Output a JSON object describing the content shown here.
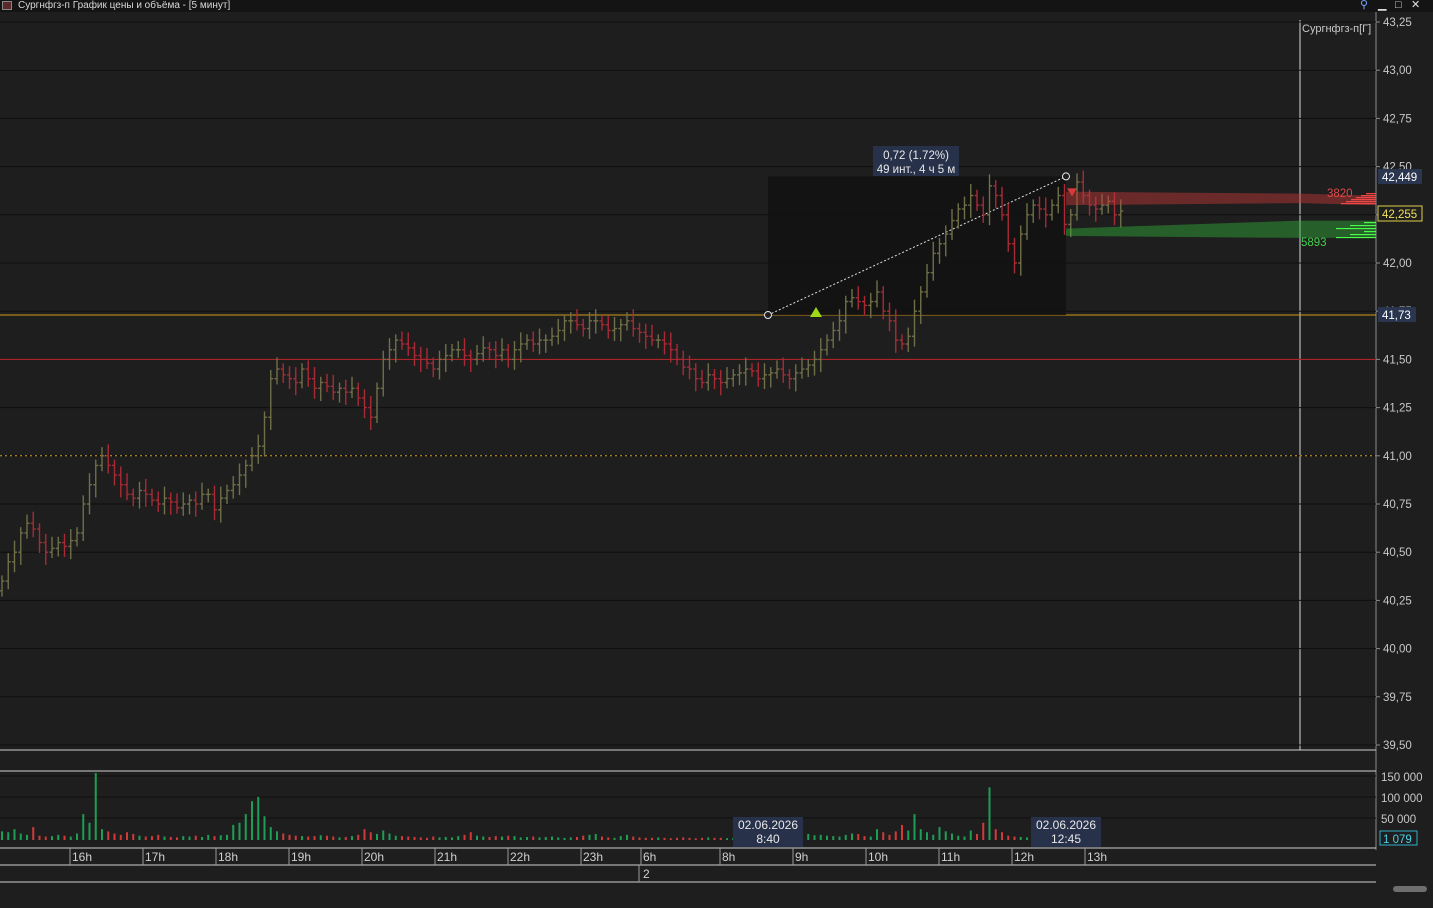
{
  "window": {
    "title": "Сургнфгз-п График цены и объёма - [5 минут]",
    "controls": {
      "pin": "⚲",
      "minimize": "▁",
      "maximize": "□",
      "close": "✕"
    }
  },
  "colors": {
    "background": "#1e1e1e",
    "grid": "#111111",
    "up_candle": "#6f6f48",
    "down_candle": "#a82a35",
    "level_line": "#d29a17",
    "support_line": "#c0282e",
    "dotted_line": "#d7a321",
    "volume_up": "#1e9e55",
    "volume_down": "#d23a3a",
    "measure_box": "#121212",
    "ask_profile": "#c83a3a",
    "bid_profile": "#33b03a"
  },
  "price_panel": {
    "instrument_label": "Сургнфгз-п[Г]",
    "tick_labels": [
      "43,25",
      "43,00",
      "42,75",
      "42,50",
      "42,25",
      "42,00",
      "41,75",
      "41,50",
      "41,25",
      "41,00",
      "40,75",
      "40,50",
      "40,25",
      "40,00",
      "39,75",
      "39,50"
    ],
    "markers": {
      "high_mark": "42,449",
      "last_price": "42,255",
      "level": "41,73"
    },
    "ask_volume_label": "3820",
    "bid_volume_label": "5893",
    "measure_tooltip": {
      "line1": "0,72 (1.72%)",
      "line2": "49 инт., 4 ч 5 м"
    }
  },
  "volume_panel": {
    "tick_labels": [
      "150 000",
      "100 000",
      "50 000"
    ],
    "last_volume": "1 079",
    "cursor_labels": [
      {
        "date": "02.06.2026",
        "time": "8:40"
      },
      {
        "date": "02.06.2026",
        "time": "12:45"
      }
    ]
  },
  "time_axis": {
    "labels": [
      "16h",
      "17h",
      "18h",
      "19h",
      "20h",
      "21h",
      "22h",
      "23h",
      "6h",
      "8h",
      "9h",
      "10h",
      "11h",
      "12h",
      "13h"
    ],
    "day_label": "2"
  },
  "chart_data": {
    "type": "candlestick",
    "interval": "5 минут",
    "ylim": [
      39.5,
      43.25
    ],
    "volume_ylim": [
      0,
      160000
    ],
    "horizontal_levels": [
      {
        "price": 41.73,
        "style": "solid",
        "color": "#d29a17"
      },
      {
        "price": 41.5,
        "style": "solid",
        "color": "#c0282e"
      },
      {
        "price": 41.0,
        "style": "dotted",
        "color": "#d7a321"
      }
    ],
    "measurement": {
      "start": {
        "time": "8:40",
        "price": 41.73
      },
      "end": {
        "time": "12:45",
        "price": 42.449
      },
      "change": "0,72 (1.72%)",
      "span": "49 инт., 4 ч 5 м"
    },
    "series_close": [
      40.35,
      40.45,
      40.5,
      40.6,
      40.65,
      40.62,
      40.55,
      40.5,
      40.52,
      40.55,
      40.53,
      40.56,
      40.6,
      40.75,
      40.85,
      40.95,
      41.0,
      40.95,
      40.9,
      40.85,
      40.8,
      40.78,
      40.82,
      40.8,
      40.77,
      40.75,
      40.78,
      40.76,
      40.73,
      40.75,
      40.77,
      40.75,
      40.8,
      40.8,
      40.72,
      40.78,
      40.82,
      40.85,
      40.9,
      40.95,
      41.0,
      41.05,
      41.2,
      41.4,
      41.45,
      41.42,
      41.4,
      41.38,
      41.45,
      41.4,
      41.35,
      41.38,
      41.36,
      41.33,
      41.35,
      41.33,
      41.35,
      41.3,
      41.25,
      41.2,
      41.35,
      41.5,
      41.55,
      41.6,
      41.58,
      41.56,
      41.52,
      41.5,
      41.48,
      41.45,
      41.5,
      41.52,
      41.55,
      41.55,
      41.52,
      41.5,
      41.53,
      41.56,
      41.55,
      41.52,
      41.55,
      41.5,
      41.55,
      41.58,
      41.6,
      41.58,
      41.6,
      41.6,
      41.62,
      41.65,
      41.7,
      41.7,
      41.68,
      41.66,
      41.7,
      41.7,
      41.68,
      41.65,
      41.66,
      41.68,
      41.7,
      41.66,
      41.64,
      41.62,
      41.6,
      41.6,
      41.58,
      41.55,
      41.5,
      41.46,
      41.45,
      41.4,
      41.38,
      41.42,
      41.4,
      41.38,
      41.4,
      41.42,
      41.43,
      41.45,
      41.44,
      41.4,
      41.42,
      41.43,
      41.45,
      41.42,
      41.4,
      41.43,
      41.45,
      41.47,
      41.5,
      41.55,
      41.6,
      41.65,
      41.7,
      41.8,
      41.82,
      41.8,
      41.78,
      41.8,
      41.85,
      41.75,
      41.7,
      41.6,
      41.58,
      41.62,
      41.75,
      41.85,
      41.95,
      42.05,
      42.1,
      42.15,
      42.22,
      42.28,
      42.3,
      42.35,
      42.3,
      42.25,
      42.4,
      42.35,
      42.25,
      42.1,
      42.0,
      42.15,
      42.25,
      42.3,
      42.28,
      42.25,
      42.3,
      42.35,
      42.2,
      42.25,
      42.42,
      42.35,
      42.3,
      42.28,
      42.3,
      42.32,
      42.25,
      42.27
    ],
    "volumes": [
      20000,
      18000,
      25000,
      15000,
      12000,
      30000,
      10000,
      8000,
      9000,
      12000,
      10000,
      8000,
      15000,
      60000,
      40000,
      155000,
      25000,
      20000,
      15000,
      12000,
      18000,
      14000,
      10000,
      8000,
      9000,
      12000,
      8000,
      7000,
      6000,
      9000,
      8000,
      10000,
      7000,
      12000,
      9000,
      11000,
      12000,
      35000,
      40000,
      60000,
      90000,
      100000,
      55000,
      30000,
      20000,
      15000,
      12000,
      10000,
      9000,
      8000,
      9000,
      11000,
      10000,
      8000,
      6000,
      7000,
      9000,
      12000,
      25000,
      18000,
      14000,
      22000,
      15000,
      10000,
      9000,
      8000,
      7000,
      6000,
      5000,
      8000,
      6000,
      7000,
      6000,
      9000,
      12000,
      18000,
      10000,
      8000,
      7000,
      9000,
      8000,
      10000,
      9000,
      6000,
      7000,
      8000,
      6000,
      7000,
      8000,
      6000,
      5000,
      6000,
      7000,
      10000,
      12000,
      14000,
      8000,
      6000,
      5000,
      9000,
      12000,
      8000,
      6000,
      5000,
      5000,
      6000,
      5000,
      4000,
      5000,
      6000,
      5000,
      4000,
      5000,
      6000,
      5000,
      5000,
      4000,
      5000,
      6000,
      5000,
      4000,
      6000,
      5000,
      8000,
      10000,
      12000,
      9000,
      8000,
      20000,
      14000,
      11000,
      12000,
      10000,
      9000,
      8000,
      12000,
      15000,
      14000,
      9000,
      8000,
      25000,
      18000,
      12000,
      20000,
      35000,
      22000,
      60000,
      25000,
      18000,
      12000,
      30000,
      20000,
      15000,
      10000,
      8000,
      22000,
      14000,
      40000,
      122000,
      25000,
      18000,
      10000,
      8000,
      7000,
      6000,
      5000,
      4000,
      5000,
      6000,
      5000,
      4000,
      6000,
      5000,
      4000,
      3000
    ]
  }
}
